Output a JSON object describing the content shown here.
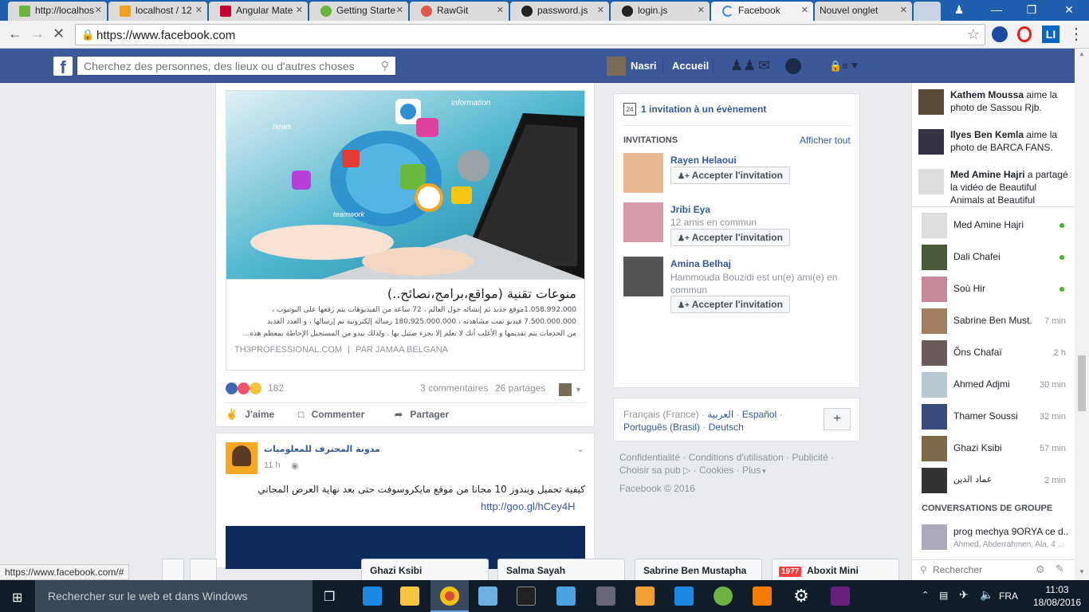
{
  "browser": {
    "tabs": [
      {
        "label": "http://localhos",
        "color": "#6db33f"
      },
      {
        "label": "localhost / 12",
        "color": "#f0a020"
      },
      {
        "label": "Angular Mate",
        "color": "#c3002f"
      },
      {
        "label": "Getting Starte",
        "color": "#6db33f"
      },
      {
        "label": "RawGit",
        "color": "#e0584a"
      },
      {
        "label": "password.js",
        "color": "#222222"
      },
      {
        "label": "login.js",
        "color": "#222222"
      },
      {
        "label": "Facebook",
        "color": "#3b5998"
      },
      {
        "label": "Nouvel onglet",
        "color": "#dddddd"
      }
    ],
    "url": "https://www.facebook.com",
    "status_url": "https://www.facebook.com/#"
  },
  "fb": {
    "search_placeholder": "Cherchez des personnes, des lieux ou d'autres choses",
    "user_name": "Nasri",
    "home_label": "Accueil"
  },
  "post1": {
    "link_title": "منوعات تقنية (مواقع،برامج،نصائح..)",
    "link_desc_1": "1.058.992.000موقع جديد تم إنشائه حول العالم ، 72 ساعة من الفيديوهات يتم رفعها على اليوتيوب ،",
    "link_desc_2": "7.500.000.000 فيديو تمت مشاهدته ، 180.925.000.000 رسالة إلكترونية تم إرسالها ، و العدد العديد",
    "link_desc_3": "من الخدمات يتم تقديمها و الأغلب أنك لا تعلم إلا بجزء ضئيل بها . ولذلك يبدو من المستحيل الإحاطة بمعظم هذه...",
    "link_source": "TH3PROFESSIONAL.COM",
    "link_author": "PAR JAMAA BELGANA",
    "reactions_count": "182",
    "comments": "3 commentaires",
    "shares": "26 partages",
    "like": "J'aime",
    "comment": "Commenter",
    "share": "Partager"
  },
  "post2": {
    "page_name": "مدونة المحترف للمعلوميات",
    "time": "11 h",
    "text": "كيفية تحميل ويندوز 10 مجانا من موقع مايكروسوفت حتى بعد نهاية العرض المجاني",
    "link": "http://goo.gl/hCey4H"
  },
  "events": {
    "invite_count": "1 invitation à un évènement",
    "invitations_header": "INVITATIONS",
    "see_all": "Afficher tout",
    "accept_label": "Accepter l'invitation",
    "people": [
      {
        "name": "Rayen Helaoui",
        "sub": ""
      },
      {
        "name": "Jribi Eya",
        "sub": "12 amis en commun"
      },
      {
        "name": "Amina Belhaj",
        "sub": "Hammouda Bouzidi est un(e) ami(e) en commun"
      }
    ]
  },
  "languages": {
    "current": "Français (France)",
    "sep": "·",
    "arabic": "العربية",
    "spanish": "Español",
    "portuguese": "Português (Brasil)",
    "german": "Deutsch",
    "add": "+"
  },
  "footer": {
    "privacy": "Confidentialité",
    "terms": "Conditions d'utilisation",
    "ads": "Publicité",
    "adchoices": "Choisir sa pub",
    "cookies": "Cookies",
    "more": "Plus",
    "copyright": "Facebook © 2016"
  },
  "ticker": [
    {
      "name": "Kathem Moussa",
      "text": " aime la photo de Sassou Rjb."
    },
    {
      "name": "Ilyes Ben Kemla",
      "text": " aime la photo de BARCA FANS."
    },
    {
      "name": "Med Amine Hajri",
      "text": " a partagé la vidéo de Beautiful Animals at Beautiful"
    }
  ],
  "chat": [
    {
      "name": "Med Amine Hajri",
      "status": "online"
    },
    {
      "name": "Dali Chafei",
      "status": "online"
    },
    {
      "name": "Soù Hir",
      "status": "online"
    },
    {
      "name": "Sabrine Ben Must...",
      "status": "7 min"
    },
    {
      "name": "Õns Chafaï",
      "status": "2 h"
    },
    {
      "name": "Ahmed Adjmi",
      "status": "30 min"
    },
    {
      "name": "Thamer Soussi",
      "status": "32 min"
    },
    {
      "name": "Ghazi Ksibi",
      "status": "57 min"
    },
    {
      "name": "عماد الدين",
      "status": "2 min"
    }
  ],
  "group_header": "CONVERSATIONS DE GROUPE",
  "group": {
    "name": "prog mechya 9ORYA ce d...",
    "members": "Ahmed, Abderrahmen, Ala, 4 ..."
  },
  "chat_search_placeholder": "Rechercher",
  "chat_tabs": [
    "Ghazi Ksibi",
    "Salma Sayah",
    "Sabrine Ben Mustapha",
    "Aboxit Mini"
  ],
  "chat_tab_badge": "1977",
  "taskbar": {
    "search_placeholder": "Rechercher sur le web et dans Windows",
    "lang": "FRA",
    "time": "11:03",
    "date": "18/08/2016"
  }
}
